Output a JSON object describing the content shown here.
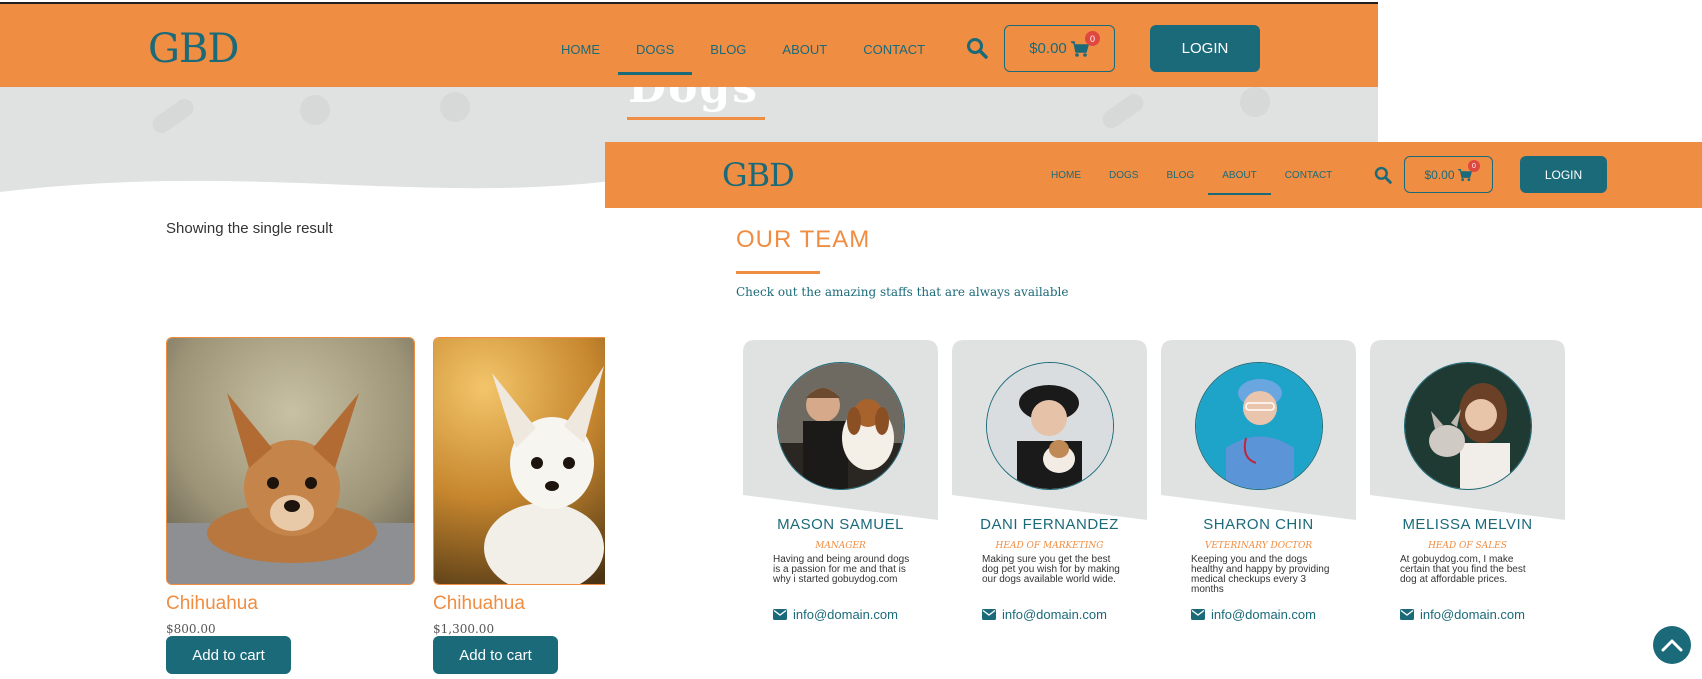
{
  "colors": {
    "orange": "#ef8d42",
    "teal": "#1b6a7a",
    "badge": "#e0473e",
    "hero_gray": "#dfe2e1"
  },
  "back_page": {
    "logo": "GBD",
    "nav": [
      "HOME",
      "DOGS",
      "BLOG",
      "ABOUT",
      "CONTACT"
    ],
    "active_nav": "DOGS",
    "cart_total": "$0.00",
    "cart_count": "0",
    "login_label": "LOGIN",
    "hero_title": "Dogs",
    "result_count": "Showing the single result",
    "products": [
      {
        "name": "Chihuahua",
        "price": "$800.00",
        "button": "Add to cart"
      },
      {
        "name": "Chihuahua",
        "price": "$1,300.00",
        "button": "Add to cart"
      }
    ]
  },
  "front_page": {
    "logo": "GBD",
    "nav": [
      "HOME",
      "DOGS",
      "BLOG",
      "ABOUT",
      "CONTACT"
    ],
    "active_nav": "ABOUT",
    "cart_total": "$0.00",
    "cart_count": "0",
    "login_label": "LOGIN",
    "team_title": "OUR TEAM",
    "team_subtitle": "Check out the amazing staffs that are always available",
    "members": [
      {
        "name": "MASON SAMUEL",
        "role": "MANAGER",
        "description": "Having and being around dogs is a passion for me and that is why i started gobuydog.com",
        "email": "info@domain.com"
      },
      {
        "name": "DANI FERNANDEZ",
        "role": "HEAD OF MARKETING",
        "description": "Making sure you get the best dog pet you wish for by making our dogs available world wide.",
        "email": "info@domain.com"
      },
      {
        "name": "SHARON CHIN",
        "role": "VETERINARY DOCTOR",
        "description": "Keeping you and the dogs healthy and happy by providing medical checkups every 3 months",
        "email": "info@domain.com"
      },
      {
        "name": "MELISSA MELVIN",
        "role": "HEAD OF SALES",
        "description": "At gobuydog.com, I make certain that you find the best dog at affordable prices.",
        "email": "info@domain.com"
      }
    ]
  },
  "icons": {
    "search": "search-icon",
    "cart": "cart-icon",
    "email": "envelope-icon",
    "scroll_top": "chevron-up-icon"
  }
}
